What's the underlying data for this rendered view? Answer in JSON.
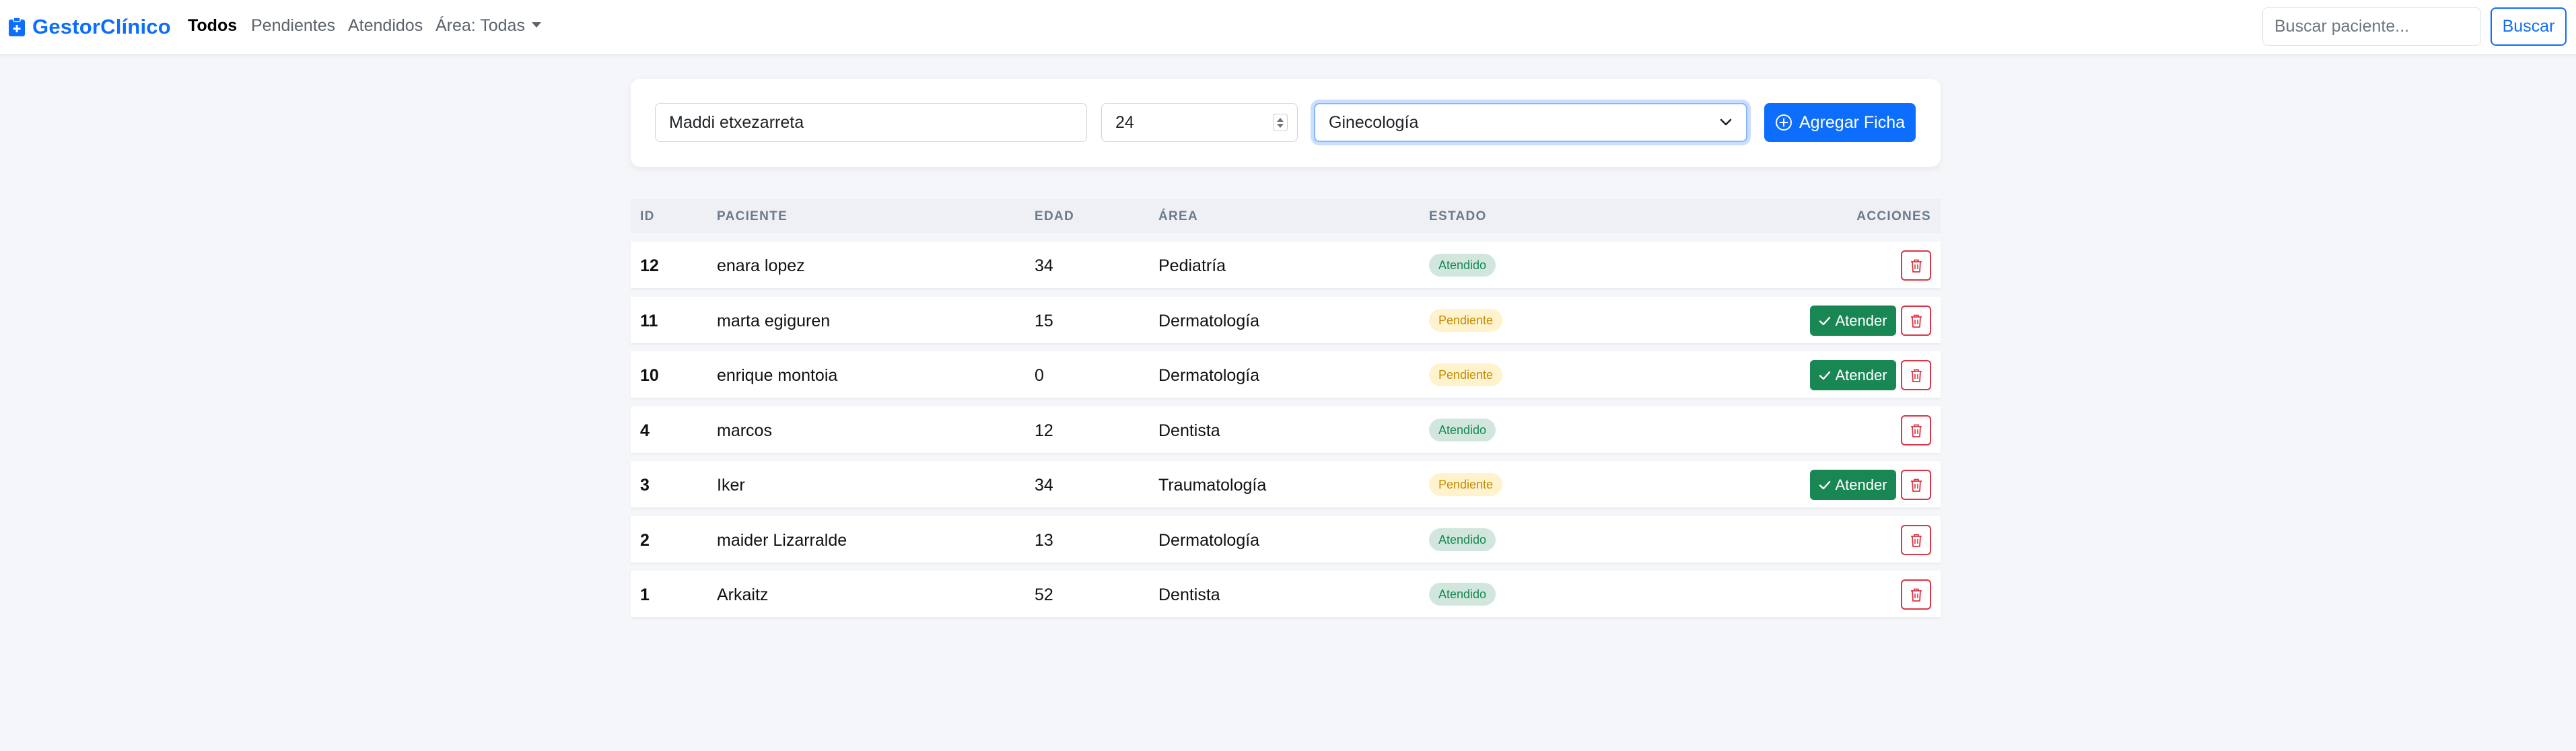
{
  "navbar": {
    "brand": "GestorClínico",
    "links": [
      {
        "label": "Todos",
        "active": true
      },
      {
        "label": "Pendientes",
        "active": false
      },
      {
        "label": "Atendidos",
        "active": false
      }
    ],
    "area_dropdown": "Área: Todas",
    "search_placeholder": "Buscar paciente...",
    "search_button": "Buscar"
  },
  "form": {
    "name_value": "Maddi etxezarreta",
    "age_value": "24",
    "area_value": "Ginecología",
    "add_button": "Agregar Ficha"
  },
  "table": {
    "headers": {
      "id": "ID",
      "paciente": "PACIENTE",
      "edad": "EDAD",
      "area": "ÁREA",
      "estado": "ESTADO",
      "acciones": "ACCIONES"
    },
    "rows": [
      {
        "id": "12",
        "paciente": "enara lopez",
        "edad": "34",
        "area": "Pediatría",
        "estado": "Atendido"
      },
      {
        "id": "11",
        "paciente": "marta egiguren",
        "edad": "15",
        "area": "Dermatología",
        "estado": "Pendiente",
        "action": "Atender"
      },
      {
        "id": "10",
        "paciente": "enrique montoia",
        "edad": "0",
        "area": "Dermatología",
        "estado": "Pendiente",
        "action": "Atender"
      },
      {
        "id": "4",
        "paciente": "marcos",
        "edad": "12",
        "area": "Dentista",
        "estado": "Atendido"
      },
      {
        "id": "3",
        "paciente": "Iker",
        "edad": "34",
        "area": "Traumatología",
        "estado": "Pendiente",
        "action": "Atender"
      },
      {
        "id": "2",
        "paciente": "maider Lizarralde",
        "edad": "13",
        "area": "Dermatología",
        "estado": "Atendido"
      },
      {
        "id": "1",
        "paciente": "Arkaitz",
        "edad": "52",
        "area": "Dentista",
        "estado": "Atendido"
      }
    ]
  },
  "colors": {
    "primary": "#0d6efd",
    "success": "#198754",
    "danger": "#dc3545",
    "badge_atendido_bg": "#d1e7dd",
    "badge_pendiente_bg": "#fff3cd",
    "page_bg": "#f4f6f9"
  },
  "icons": {
    "brand": "clipboard-icon",
    "add": "plus-circle-icon",
    "atender": "check-icon",
    "delete": "trash-icon",
    "select": "chevron-down-icon"
  }
}
